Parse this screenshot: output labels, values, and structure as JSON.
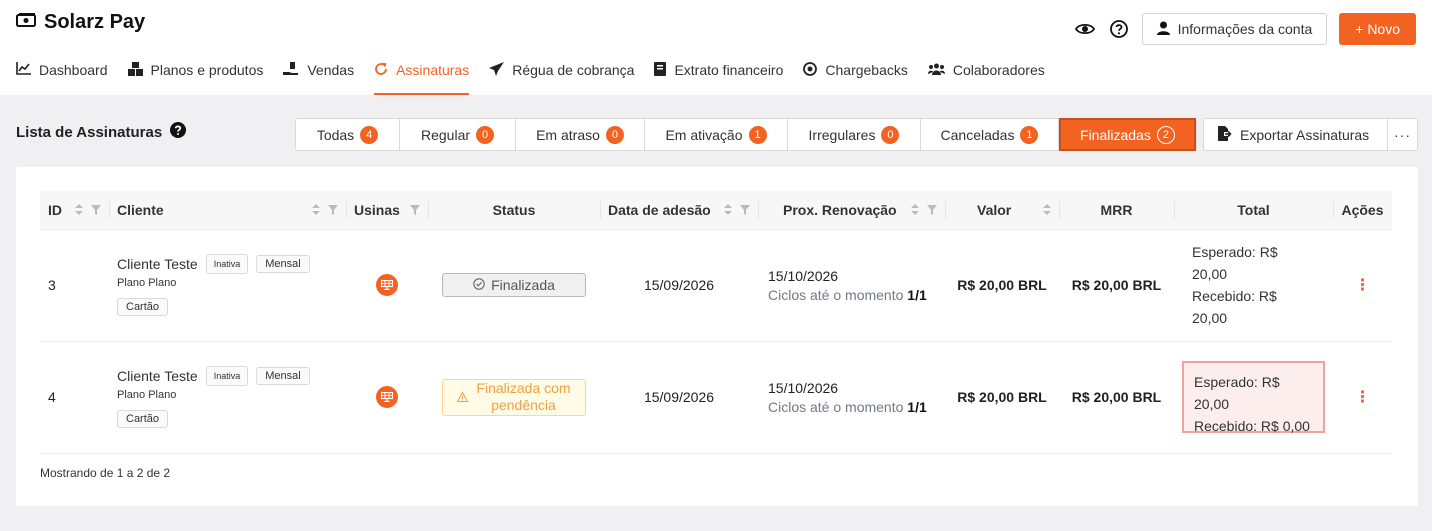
{
  "app": {
    "title": "Solarz Pay"
  },
  "header": {
    "account_label": "Informações da conta",
    "new_label": "+ Novo"
  },
  "nav": {
    "items": [
      {
        "label": "Dashboard",
        "icon": "chart-line-icon",
        "active": false
      },
      {
        "label": "Planos e produtos",
        "icon": "boxes-icon",
        "active": false
      },
      {
        "label": "Vendas",
        "icon": "hand-money-icon",
        "active": false
      },
      {
        "label": "Assinaturas",
        "icon": "refresh-icon",
        "active": true
      },
      {
        "label": "Régua de cobrança",
        "icon": "paper-plane-icon",
        "active": false
      },
      {
        "label": "Extrato financeiro",
        "icon": "book-icon",
        "active": false
      },
      {
        "label": "Chargebacks",
        "icon": "coin-icon",
        "active": false
      },
      {
        "label": "Colaboradores",
        "icon": "users-icon",
        "active": false
      }
    ]
  },
  "list": {
    "title": "Lista de Assinaturas",
    "filters": [
      {
        "label": "Todas",
        "count": "4",
        "active": false
      },
      {
        "label": "Regular",
        "count": "0",
        "active": false
      },
      {
        "label": "Em atraso",
        "count": "0",
        "active": false
      },
      {
        "label": "Em ativação",
        "count": "1",
        "active": false
      },
      {
        "label": "Irregulares",
        "count": "0",
        "active": false
      },
      {
        "label": "Canceladas",
        "count": "1",
        "active": false
      },
      {
        "label": "Finalizadas",
        "count": "2",
        "active": true
      }
    ],
    "export_label": "Exportar Assinaturas",
    "more_label": "···"
  },
  "table": {
    "columns": [
      "ID",
      "Cliente",
      "Usinas",
      "Status",
      "Data de adesão",
      "Prox. Renovação",
      "Valor",
      "MRR",
      "Total",
      "Ações"
    ],
    "rows": [
      {
        "id": "3",
        "client": "Cliente Teste",
        "client_status": "Inativa",
        "period": "Mensal",
        "plan": "Plano Plano",
        "payment": "Cartão",
        "status": "Finalizada",
        "status_type": "done",
        "joined": "15/09/2026",
        "renewal": "15/10/2026",
        "cycles_label": "Ciclos até o momento",
        "cycles": "1/1",
        "value": "R$ 20,00 BRL",
        "mrr": "R$ 20,00 BRL",
        "expected": "Esperado: R$ 20,00",
        "received": "Recebido: R$ 20,00",
        "alert": false
      },
      {
        "id": "4",
        "client": "Cliente Teste",
        "client_status": "Inativa",
        "period": "Mensal",
        "plan": "Plano Plano",
        "payment": "Cartão",
        "status": "Finalizada com pendência",
        "status_line1": "Finalizada com",
        "status_line2": "pendência",
        "status_type": "pending",
        "joined": "15/09/2026",
        "renewal": "15/10/2026",
        "cycles_label": "Ciclos até o momento",
        "cycles": "1/1",
        "value": "R$ 20,00 BRL",
        "mrr": "R$ 20,00 BRL",
        "expected": "Esperado: R$ 20,00",
        "received": "Recebido: R$ 0,00",
        "alert": true
      }
    ],
    "footer": "Mostrando de 1 a 2 de 2"
  },
  "colors": {
    "accent": "#f26322",
    "alert_bg": "#fdeeee",
    "alert_border": "#f2a0a0",
    "pending": "#f0a040"
  }
}
